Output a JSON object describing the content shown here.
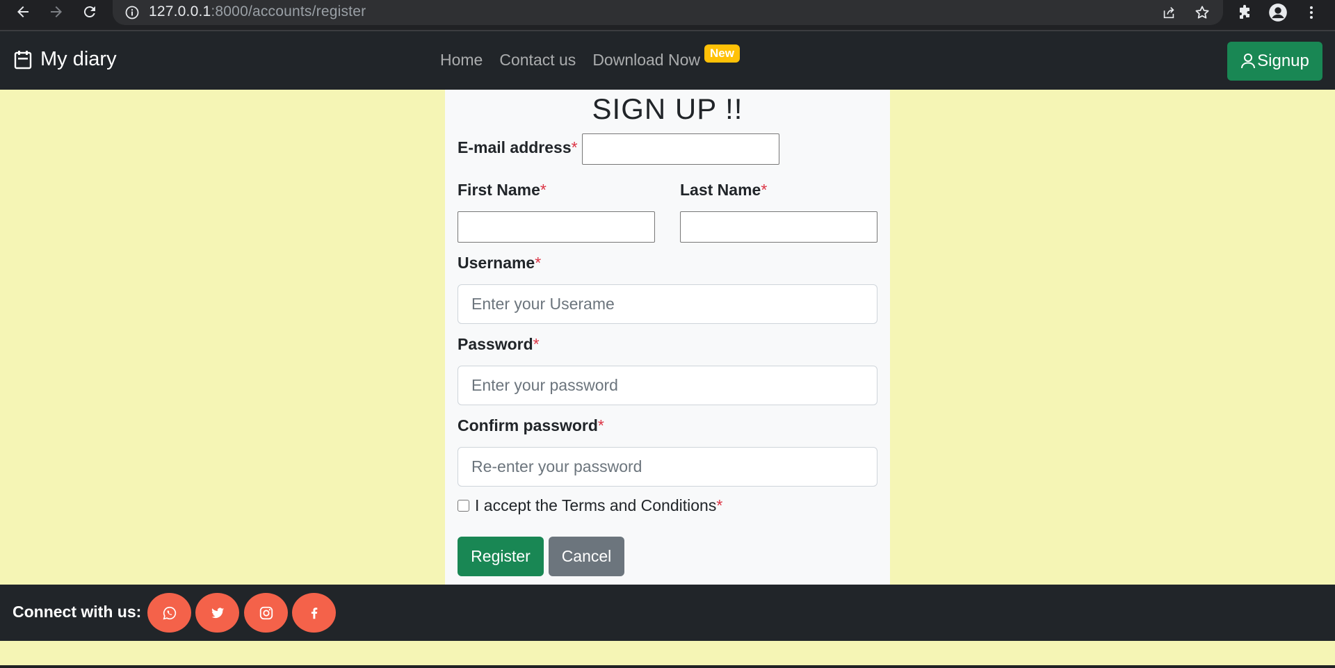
{
  "browser": {
    "url_host": "127.0.0.1",
    "url_rest": ":8000/accounts/register"
  },
  "navbar": {
    "brand": "My diary",
    "links": [
      "Home",
      "Contact us",
      "Download Now"
    ],
    "new_badge": "New",
    "signup_label": "Signup"
  },
  "form": {
    "title": "SIGN UP !!",
    "email_label": "E-mail address",
    "first_name_label": "First Name",
    "last_name_label": "Last Name",
    "username_label": "Username",
    "username_placeholder": "Enter your Userame",
    "password_label": "Password",
    "password_placeholder": "Enter your password",
    "confirm_label": "Confirm password",
    "confirm_placeholder": "Re-enter your password",
    "terms_label": "I accept the Terms and Conditions",
    "required_mark": "*",
    "register_label": "Register",
    "cancel_label": "Cancel"
  },
  "footer": {
    "connect_label": "Connect with us:",
    "socials": [
      "whatsapp-icon",
      "twitter-icon",
      "instagram-icon",
      "facebook-icon"
    ]
  },
  "colors": {
    "page_bg": "#f5f5b5",
    "navbar_bg": "#212529",
    "success": "#198754",
    "secondary": "#6c757d",
    "social": "#f4624a",
    "badge": "#ffc107"
  }
}
